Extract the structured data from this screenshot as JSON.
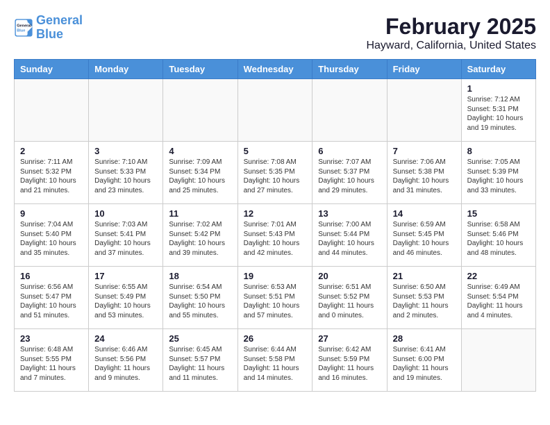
{
  "header": {
    "logo_line1": "General",
    "logo_line2": "Blue",
    "month": "February 2025",
    "location": "Hayward, California, United States"
  },
  "days_of_week": [
    "Sunday",
    "Monday",
    "Tuesday",
    "Wednesday",
    "Thursday",
    "Friday",
    "Saturday"
  ],
  "weeks": [
    [
      {
        "day": "",
        "info": ""
      },
      {
        "day": "",
        "info": ""
      },
      {
        "day": "",
        "info": ""
      },
      {
        "day": "",
        "info": ""
      },
      {
        "day": "",
        "info": ""
      },
      {
        "day": "",
        "info": ""
      },
      {
        "day": "1",
        "info": "Sunrise: 7:12 AM\nSunset: 5:31 PM\nDaylight: 10 hours\nand 19 minutes."
      }
    ],
    [
      {
        "day": "2",
        "info": "Sunrise: 7:11 AM\nSunset: 5:32 PM\nDaylight: 10 hours\nand 21 minutes."
      },
      {
        "day": "3",
        "info": "Sunrise: 7:10 AM\nSunset: 5:33 PM\nDaylight: 10 hours\nand 23 minutes."
      },
      {
        "day": "4",
        "info": "Sunrise: 7:09 AM\nSunset: 5:34 PM\nDaylight: 10 hours\nand 25 minutes."
      },
      {
        "day": "5",
        "info": "Sunrise: 7:08 AM\nSunset: 5:35 PM\nDaylight: 10 hours\nand 27 minutes."
      },
      {
        "day": "6",
        "info": "Sunrise: 7:07 AM\nSunset: 5:37 PM\nDaylight: 10 hours\nand 29 minutes."
      },
      {
        "day": "7",
        "info": "Sunrise: 7:06 AM\nSunset: 5:38 PM\nDaylight: 10 hours\nand 31 minutes."
      },
      {
        "day": "8",
        "info": "Sunrise: 7:05 AM\nSunset: 5:39 PM\nDaylight: 10 hours\nand 33 minutes."
      }
    ],
    [
      {
        "day": "9",
        "info": "Sunrise: 7:04 AM\nSunset: 5:40 PM\nDaylight: 10 hours\nand 35 minutes."
      },
      {
        "day": "10",
        "info": "Sunrise: 7:03 AM\nSunset: 5:41 PM\nDaylight: 10 hours\nand 37 minutes."
      },
      {
        "day": "11",
        "info": "Sunrise: 7:02 AM\nSunset: 5:42 PM\nDaylight: 10 hours\nand 39 minutes."
      },
      {
        "day": "12",
        "info": "Sunrise: 7:01 AM\nSunset: 5:43 PM\nDaylight: 10 hours\nand 42 minutes."
      },
      {
        "day": "13",
        "info": "Sunrise: 7:00 AM\nSunset: 5:44 PM\nDaylight: 10 hours\nand 44 minutes."
      },
      {
        "day": "14",
        "info": "Sunrise: 6:59 AM\nSunset: 5:45 PM\nDaylight: 10 hours\nand 46 minutes."
      },
      {
        "day": "15",
        "info": "Sunrise: 6:58 AM\nSunset: 5:46 PM\nDaylight: 10 hours\nand 48 minutes."
      }
    ],
    [
      {
        "day": "16",
        "info": "Sunrise: 6:56 AM\nSunset: 5:47 PM\nDaylight: 10 hours\nand 51 minutes."
      },
      {
        "day": "17",
        "info": "Sunrise: 6:55 AM\nSunset: 5:49 PM\nDaylight: 10 hours\nand 53 minutes."
      },
      {
        "day": "18",
        "info": "Sunrise: 6:54 AM\nSunset: 5:50 PM\nDaylight: 10 hours\nand 55 minutes."
      },
      {
        "day": "19",
        "info": "Sunrise: 6:53 AM\nSunset: 5:51 PM\nDaylight: 10 hours\nand 57 minutes."
      },
      {
        "day": "20",
        "info": "Sunrise: 6:51 AM\nSunset: 5:52 PM\nDaylight: 11 hours\nand 0 minutes."
      },
      {
        "day": "21",
        "info": "Sunrise: 6:50 AM\nSunset: 5:53 PM\nDaylight: 11 hours\nand 2 minutes."
      },
      {
        "day": "22",
        "info": "Sunrise: 6:49 AM\nSunset: 5:54 PM\nDaylight: 11 hours\nand 4 minutes."
      }
    ],
    [
      {
        "day": "23",
        "info": "Sunrise: 6:48 AM\nSunset: 5:55 PM\nDaylight: 11 hours\nand 7 minutes."
      },
      {
        "day": "24",
        "info": "Sunrise: 6:46 AM\nSunset: 5:56 PM\nDaylight: 11 hours\nand 9 minutes."
      },
      {
        "day": "25",
        "info": "Sunrise: 6:45 AM\nSunset: 5:57 PM\nDaylight: 11 hours\nand 11 minutes."
      },
      {
        "day": "26",
        "info": "Sunrise: 6:44 AM\nSunset: 5:58 PM\nDaylight: 11 hours\nand 14 minutes."
      },
      {
        "day": "27",
        "info": "Sunrise: 6:42 AM\nSunset: 5:59 PM\nDaylight: 11 hours\nand 16 minutes."
      },
      {
        "day": "28",
        "info": "Sunrise: 6:41 AM\nSunset: 6:00 PM\nDaylight: 11 hours\nand 19 minutes."
      },
      {
        "day": "",
        "info": ""
      }
    ]
  ]
}
